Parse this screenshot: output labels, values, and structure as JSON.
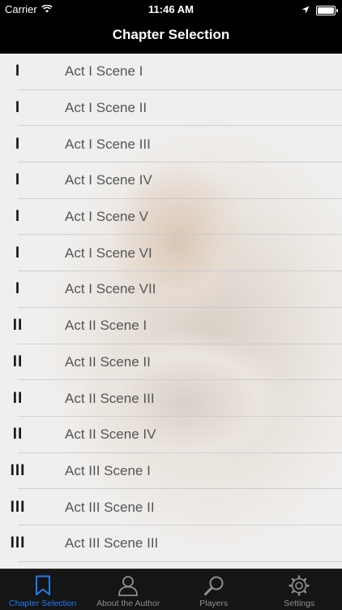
{
  "status_bar": {
    "carrier": "Carrier",
    "time": "11:46 AM"
  },
  "nav": {
    "title": "Chapter Selection"
  },
  "chapters": [
    {
      "act": "I",
      "label": "Act I Scene I"
    },
    {
      "act": "I",
      "label": "Act I Scene II"
    },
    {
      "act": "I",
      "label": "Act I Scene III"
    },
    {
      "act": "I",
      "label": "Act I Scene IV"
    },
    {
      "act": "I",
      "label": "Act I Scene V"
    },
    {
      "act": "I",
      "label": "Act I Scene VI"
    },
    {
      "act": "I",
      "label": "Act I Scene VII"
    },
    {
      "act": "II",
      "label": "Act II Scene I"
    },
    {
      "act": "II",
      "label": "Act II Scene II"
    },
    {
      "act": "II",
      "label": "Act II Scene III"
    },
    {
      "act": "II",
      "label": "Act II Scene IV"
    },
    {
      "act": "III",
      "label": "Act III Scene I"
    },
    {
      "act": "III",
      "label": "Act III Scene II"
    },
    {
      "act": "III",
      "label": "Act III Scene III"
    }
  ],
  "tabs": [
    {
      "label": "Chapter Selection",
      "icon": "bookmark-icon",
      "active": true
    },
    {
      "label": "About the Author",
      "icon": "person-icon",
      "active": false
    },
    {
      "label": "Players",
      "icon": "magnifier-icon",
      "active": false
    },
    {
      "label": "Settings",
      "icon": "gear-icon",
      "active": false
    }
  ],
  "colors": {
    "accent": "#1e7cf2",
    "tab_inactive": "#8e8e93",
    "bar_background": "#000000"
  }
}
